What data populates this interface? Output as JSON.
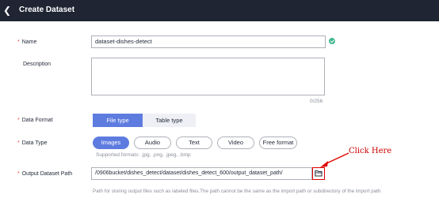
{
  "header": {
    "back_icon": "chevron-left-icon",
    "title": "Create Dataset"
  },
  "form": {
    "name": {
      "required_mark": "*",
      "label": "Name",
      "value": "dataset-dishes-detect",
      "status_icon": "check-circle-icon",
      "status_color": "#3fb68e"
    },
    "description": {
      "label": "Description",
      "value": "",
      "counter": "0/256"
    },
    "data_format": {
      "required_mark": "*",
      "label": "Data Format",
      "options": [
        "File type",
        "Table type"
      ],
      "selected": "File type"
    },
    "data_type": {
      "required_mark": "*",
      "label": "Data Type",
      "options": [
        "Images",
        "Audio",
        "Text",
        "Video",
        "Free format"
      ],
      "selected": "Images",
      "hint": "Supported formats: .jpg, .png, .jpeg, .bmp"
    },
    "output_path": {
      "required_mark": "*",
      "label": "Output Dataset Path",
      "value": "/0906bucket/dishes_detect/dataset/dishes_detect_600/output_dataset_path/",
      "browse_icon": "folder-icon",
      "help": "Path for storing output files such as labeled files.The path cannot be the same as the import path or subdirectory of the import path."
    }
  },
  "annotation": {
    "text": "Click Here",
    "color": "#cc0000"
  },
  "colors": {
    "header_bg": "#1f2533",
    "accent": "#5e7ce0",
    "required": "#e94a3b"
  }
}
